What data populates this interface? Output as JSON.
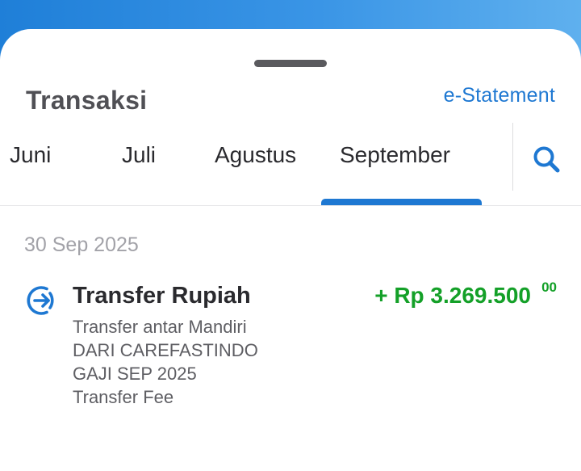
{
  "header": {
    "title": "Transaksi",
    "estatement_label": "e-Statement"
  },
  "tabs": [
    {
      "label": "Juni",
      "selected": false
    },
    {
      "label": "Juli",
      "selected": false
    },
    {
      "label": "Agustus",
      "selected": false
    },
    {
      "label": "September",
      "selected": true
    }
  ],
  "search_icon": "search-icon",
  "groups": [
    {
      "date": "30 Sep 2025",
      "transactions": [
        {
          "icon": "transfer-in-icon",
          "title": "Transfer Rupiah",
          "amount": "+ Rp 3.269.500",
          "amount_cents": "00",
          "details": [
            "Transfer antar Mandiri",
            "DARI CAREFASTINDO",
            "GAJI SEP 2025",
            "Transfer Fee"
          ]
        }
      ]
    }
  ],
  "colors": {
    "accent": "#1e78d2",
    "credit": "#14a028",
    "header_gradient_start": "#1f7fd8",
    "header_gradient_end": "#5fb0ee"
  }
}
